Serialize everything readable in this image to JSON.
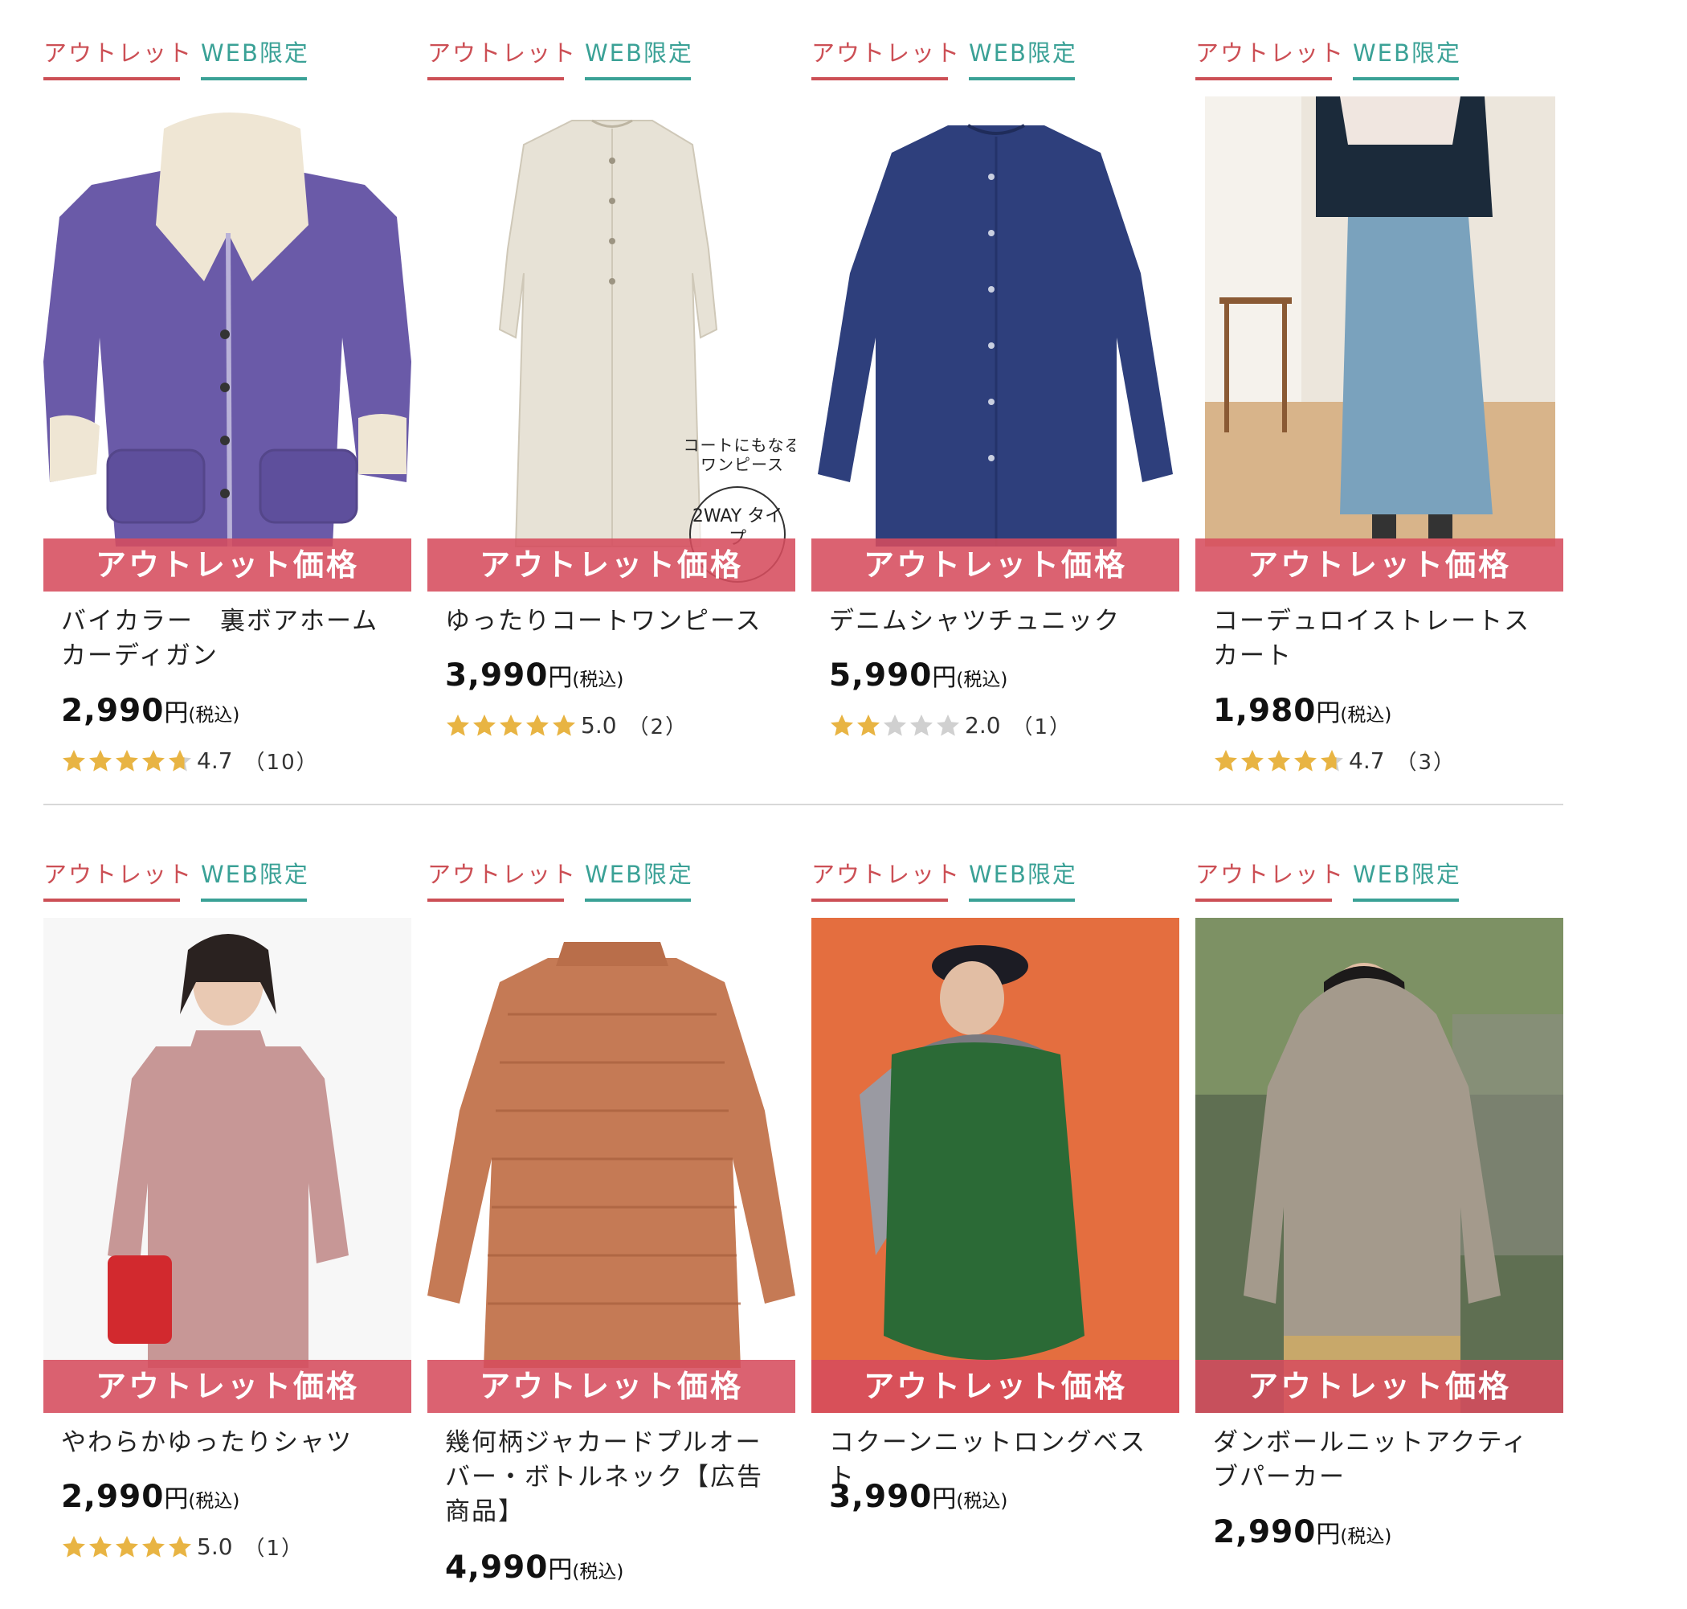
{
  "tags": {
    "outlet": "アウトレット",
    "web": "WEB限定"
  },
  "banner_label": "アウトレット価格",
  "tax_label": "(税込)",
  "yen": "円",
  "colors": {
    "outlet": "#cc4f55",
    "web": "#3aa196",
    "banner": "#d64c5d",
    "star_on": "#e8b443",
    "star_off": "#d0d0d0"
  },
  "products": [
    {
      "title": "バイカラー　裏ボアホームカーディガン",
      "price": "2,990",
      "rating": "4.7",
      "rating_value": 4.7,
      "reviews": "（10）"
    },
    {
      "title": "ゆったりコートワンピース",
      "price": "3,990",
      "rating": "5.0",
      "rating_value": 5.0,
      "reviews": "（2）",
      "badge_note": "コートにもなる ワンピース",
      "badge_circle": "2WAY タイプ"
    },
    {
      "title": "デニムシャツチュニック",
      "price": "5,990",
      "rating": "2.0",
      "rating_value": 2.0,
      "reviews": "（1）"
    },
    {
      "title": "コーデュロイストレートスカート",
      "price": "1,980",
      "rating": "4.7",
      "rating_value": 4.7,
      "reviews": "（3）"
    },
    {
      "title": "やわらかゆったりシャツ",
      "price": "2,990",
      "rating": "5.0",
      "rating_value": 5.0,
      "reviews": "（1）"
    },
    {
      "title": "幾何柄ジャカードプルオーバー・ボトルネック【広告商品】",
      "price": "4,990"
    },
    {
      "title": "コクーンニットロングベスト",
      "price": "3,990"
    },
    {
      "title": "ダンボールニットアクティブパーカー",
      "price": "2,990"
    }
  ]
}
